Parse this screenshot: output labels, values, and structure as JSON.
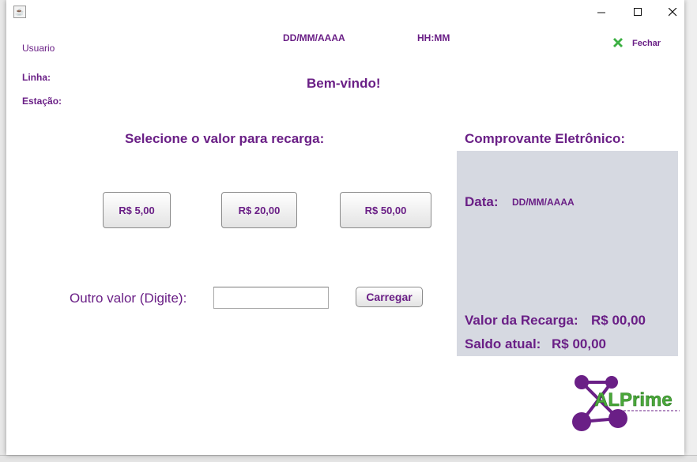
{
  "header": {
    "user_label": "Usuario",
    "date_placeholder": "DD/MM/AAAA",
    "time_placeholder": "HH:MM",
    "line_label": "Linha:",
    "station_label": "Estação:",
    "welcome": "Bem-vindo!",
    "close_label": "Fechar"
  },
  "recharge": {
    "heading": "Selecione o valor para recarga:",
    "options": [
      "R$ 5,00",
      "R$ 20,00",
      "R$ 50,00"
    ],
    "other_label": "Outro valor (Digite):",
    "other_value": "",
    "load_button": "Carregar"
  },
  "receipt": {
    "heading": "Comprovante Eletrônico:",
    "date_label": "Data:",
    "date_value": "DD/MM/AAAA",
    "recharge_value_label": "Valor da Recarga:",
    "recharge_value": "R$ 00,00",
    "balance_label": "Saldo atual:",
    "balance_value": "R$ 00,00"
  },
  "logo": {
    "text": "ALPrime"
  },
  "colors": {
    "accent": "#6a1f86",
    "panel": "#d6d9e1",
    "close_icon": "#3cb043",
    "logo_green": "#4aa83a"
  }
}
